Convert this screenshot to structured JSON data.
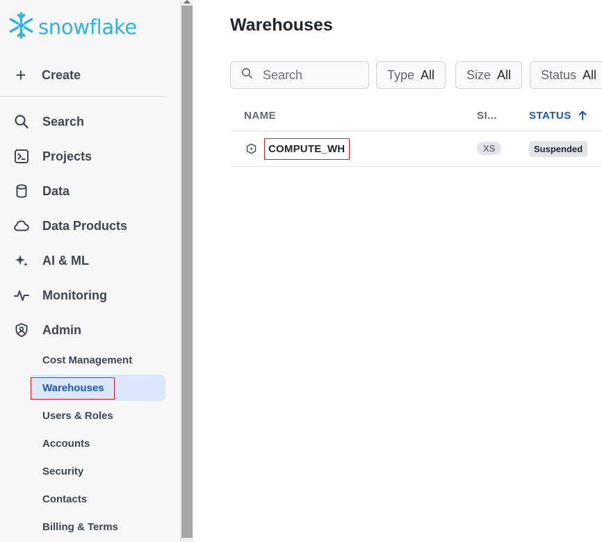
{
  "app": {
    "logo_text": "snowflake",
    "brand_color": "#29b5e8",
    "active_color": "#1a56c9",
    "highlight_color": "#e02020"
  },
  "sidebar": {
    "create_label": "Create",
    "items": [
      {
        "label": "Search",
        "icon": "search-icon"
      },
      {
        "label": "Projects",
        "icon": "terminal-icon"
      },
      {
        "label": "Data",
        "icon": "database-icon"
      },
      {
        "label": "Data Products",
        "icon": "cloud-icon"
      },
      {
        "label": "AI & ML",
        "icon": "sparkle-icon"
      },
      {
        "label": "Monitoring",
        "icon": "pulse-icon"
      },
      {
        "label": "Admin",
        "icon": "shield-user-icon"
      }
    ],
    "admin_subitems": [
      {
        "label": "Cost Management",
        "active": false
      },
      {
        "label": "Warehouses",
        "active": true
      },
      {
        "label": "Users & Roles",
        "active": false
      },
      {
        "label": "Accounts",
        "active": false
      },
      {
        "label": "Security",
        "active": false
      },
      {
        "label": "Contacts",
        "active": false
      },
      {
        "label": "Billing & Terms",
        "active": false
      }
    ]
  },
  "main": {
    "title": "Warehouses",
    "search": {
      "placeholder": "Search",
      "value": ""
    },
    "filters": [
      {
        "key": "Type",
        "value": "All"
      },
      {
        "key": "Size",
        "value": "All"
      },
      {
        "key": "Status",
        "value": "All"
      }
    ],
    "table": {
      "columns": [
        {
          "label": "NAME",
          "sorted": false
        },
        {
          "label": "SI...",
          "sorted": false
        },
        {
          "label": "STATUS",
          "sorted": true,
          "sort_direction": "ascending"
        }
      ],
      "rows": [
        {
          "name": "COMPUTE_WH",
          "size": "XS",
          "status": "Suspended"
        }
      ]
    }
  }
}
